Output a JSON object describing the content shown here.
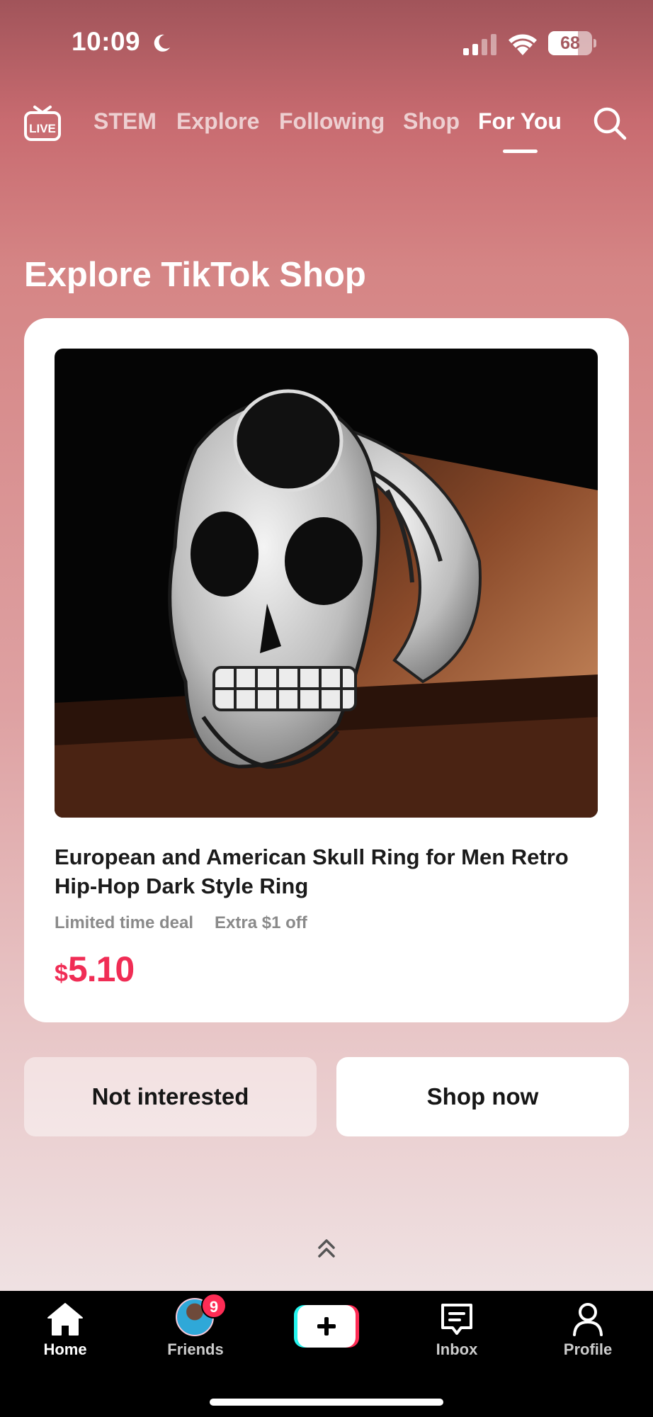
{
  "status_bar": {
    "time": "10:09",
    "battery": "68",
    "battery_level": 0.68
  },
  "top_nav": {
    "tabs": [
      {
        "label": "STEM"
      },
      {
        "label": "Explore"
      },
      {
        "label": "Following"
      },
      {
        "label": "Shop"
      },
      {
        "label": "For You"
      }
    ],
    "active_tab": "For You"
  },
  "section_title": "Explore TikTok Shop",
  "product": {
    "title": "European and American Skull Ring for Men Retro Hip-Hop Dark Style Ring",
    "deal_1": "Limited time deal",
    "deal_2": "Extra $1 off",
    "price_currency": "$",
    "price_value": "5.10"
  },
  "actions": {
    "not_interested": "Not interested",
    "shop_now": "Shop now"
  },
  "tab_bar": {
    "items": [
      {
        "label": "Home",
        "icon": "home-icon"
      },
      {
        "label": "Friends",
        "icon": "friends-avatar"
      },
      {
        "label": "",
        "icon": "create-plus-icon"
      },
      {
        "label": "Inbox",
        "icon": "inbox-icon"
      },
      {
        "label": "Profile",
        "icon": "profile-icon"
      }
    ],
    "friends_badge": "9"
  },
  "colors": {
    "accent": "#f02d55",
    "badge": "#fe2c55"
  }
}
